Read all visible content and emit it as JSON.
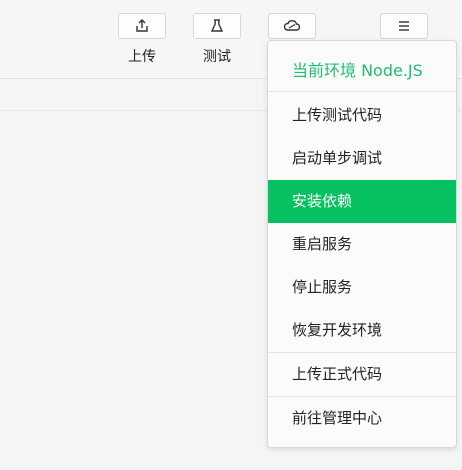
{
  "toolbar": {
    "upload_label": "上传",
    "test_label": "测试",
    "upload_icon": "upload-icon",
    "test_icon": "flask-icon",
    "cloud_icon": "cloud-icon",
    "menu_icon": "menu-icon"
  },
  "menu": {
    "header": "当前环境 Node.JS",
    "items": [
      {
        "label": "上传测试代码",
        "active": false
      },
      {
        "label": "启动单步调试",
        "active": false
      },
      {
        "label": "安装依赖",
        "active": true
      },
      {
        "label": "重启服务",
        "active": false
      },
      {
        "label": "停止服务",
        "active": false
      },
      {
        "label": "恢复开发环境",
        "active": false
      },
      {
        "label": "上传正式代码",
        "active": false
      },
      {
        "label": "前往管理中心",
        "active": false
      }
    ]
  },
  "colors": {
    "accent": "#07c160",
    "header_text": "#1fbf71"
  }
}
